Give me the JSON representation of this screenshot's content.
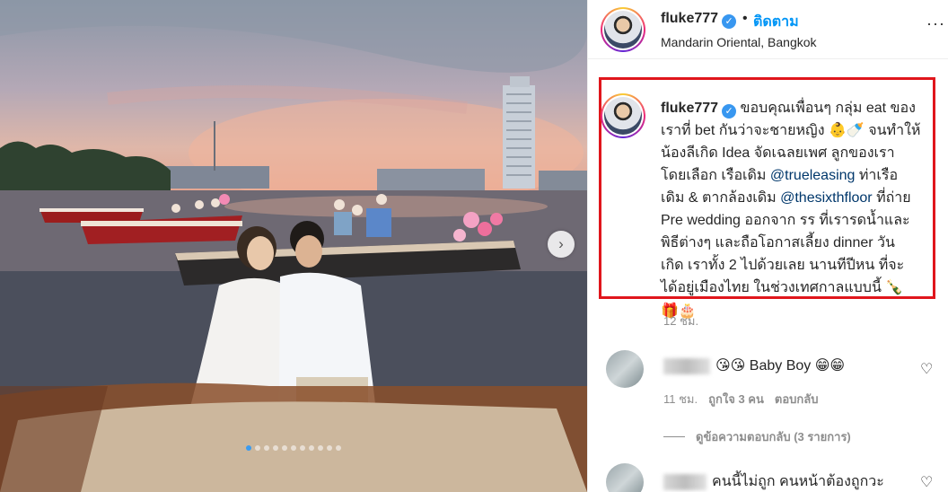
{
  "header": {
    "username": "fluke777",
    "follow_label": "ติดตาม",
    "separator": "•",
    "location": "Mandarin Oriental, Bangkok",
    "more_label": "···"
  },
  "caption": {
    "username": "fluke777",
    "lines": [
      "ขอบคุณเพื่อนๆ กลุ่ม eat ของ",
      "เราที่ bet กันว่าจะชายหญิง 👶🍼 จนทำให้",
      "น้องลีเกิด Idea จัดเฉลยเพศ ลูกของเรา",
      "โดยเลือก เรือเดิม ",
      "@trueleasing",
      " ท่าเรือ",
      "เดิม & ตากล้องเดิม ",
      "@thesixthfloor",
      " ที่ถ่าย",
      "Pre wedding ออกจาก รร ที่เรารดน้ำและ",
      "พิธีต่างๆ และถือโอกาสเลี้ยง dinner วัน",
      "เกิด เราทั้ง 2 ไปด้วยเลย นานทีปีหน ที่จะ",
      "ได้อยู่เมืองไทย ในช่วงเทศกาลแบบนี้ 🍾",
      "🎁🎂"
    ],
    "time": "12 ชม."
  },
  "comments": [
    {
      "text": "😘😘 Baby Boy 😁😁",
      "time": "11 ชม.",
      "likes": "ถูกใจ 3 คน",
      "reply": "ตอบกลับ",
      "view_replies": "ดูข้อความตอบกลับ (3 รายการ)"
    },
    {
      "text": "คนนี้ไม่ถูก คนหน้าต้องถูกวะ"
    }
  ],
  "carousel": {
    "next_icon": "›",
    "dot_count": 11,
    "active_index": 0
  },
  "colors": {
    "follow": "#0095f6",
    "highlight_box": "#e0161c",
    "mention": "#00376b",
    "verified": "#3897f0"
  }
}
